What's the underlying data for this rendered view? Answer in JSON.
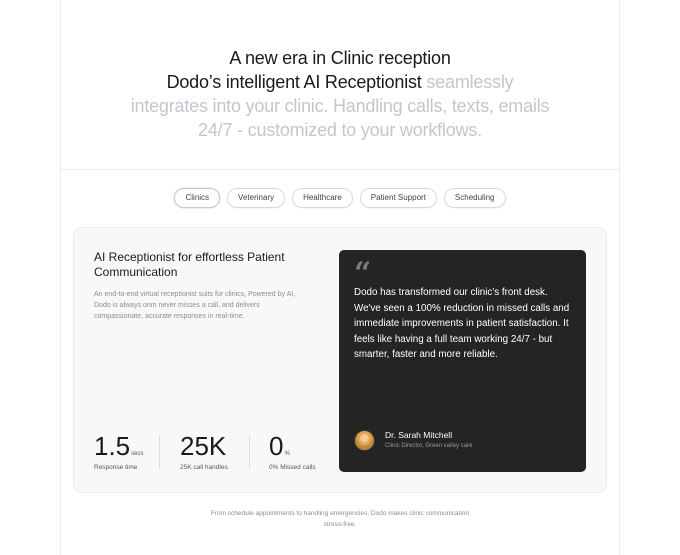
{
  "hero": {
    "line1": "A new era in Clinic reception",
    "line2_strong": "Dodo’s intelligent AI Receptionist",
    "line2_muted": " seamlessly integrates into your clinic. Handling calls, texts, emails 24/7 - customized to your workflows."
  },
  "tabs": [
    {
      "label": "Clinics",
      "active": true
    },
    {
      "label": "Veterinary",
      "active": false
    },
    {
      "label": "Healthcare",
      "active": false
    },
    {
      "label": "Patient Support",
      "active": false
    },
    {
      "label": "Scheduling",
      "active": false
    }
  ],
  "card": {
    "title": "AI Receptionist for effortless Patient Communication",
    "description": "An end-to-end virtual receptionist suits for clinics, Powered by AI, Dodo is always onm never misses a call, and delivers compassionate, accurate responses in real-time.",
    "stats": [
      {
        "value": "1.5",
        "unit": "secs",
        "label": "Response time"
      },
      {
        "value": "25K",
        "unit": "",
        "label": "25K call handles"
      },
      {
        "value": "0",
        "unit": "%",
        "label": "0% Missed calls"
      }
    ],
    "quote": {
      "mark": "“",
      "text": "Dodo has transformed our clinic’s front desk. We've seen a 100% reduction in missed calls and immediate improvements in patient satisfaction. It feels like having a full team working 24/7 - but smarter, faster and more reliable.",
      "author": "Dr. Sarah Mitchell",
      "role": "Clinic Director, Green valley care"
    }
  },
  "footer": {
    "note": "From schedule appointments to handling emergencies, Dodo makes clinic communication stress-free."
  },
  "colors": {
    "muted_text": "#c4c6cc",
    "quote_bg": "#242424",
    "card_bg": "#f8f8f9"
  }
}
